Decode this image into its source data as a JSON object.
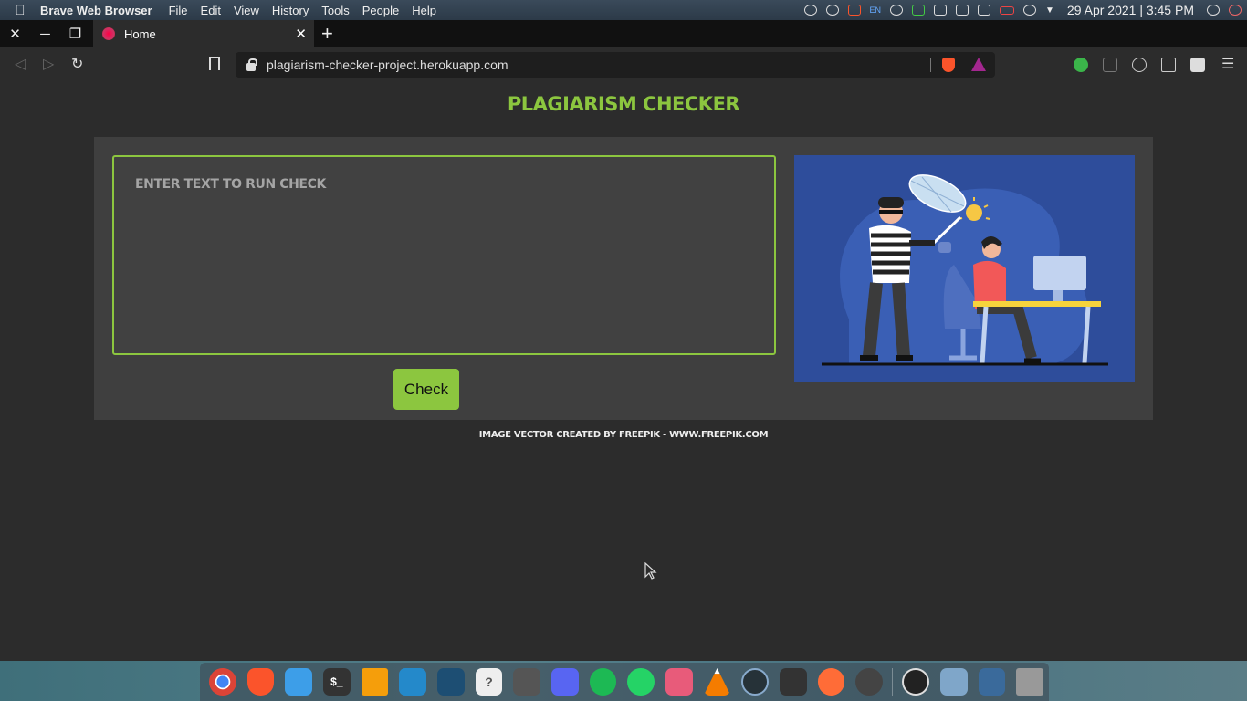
{
  "system_bar": {
    "app_name": "Brave Web Browser",
    "menus": [
      "File",
      "Edit",
      "View",
      "History",
      "Tools",
      "People",
      "Help"
    ],
    "lang": "EN",
    "datetime": "29 Apr 2021 | 3:45 PM"
  },
  "browser": {
    "tab_title": "Home",
    "url": "plagiarism-checker-project.herokuapp.com"
  },
  "page": {
    "title": "PLAGIARISM CHECKER",
    "input_placeholder": "ENTER TEXT TO RUN CHECK",
    "input_value": "",
    "check_label": "Check",
    "credit": "IMAGE VECTOR CREATED BY FREEPIK - WWW.FREEPIK.COM",
    "accent_color": "#8cc63f",
    "illustration": "thief-catching-lightbulb-from-person-at-desk"
  },
  "dock": {
    "icons": [
      "chrome-icon",
      "brave-icon",
      "files-icon",
      "terminal-icon",
      "sublime-icon",
      "vscode-icon",
      "mysql-workbench-icon",
      "unknown-app-icon",
      "calculator-icon",
      "discord-icon",
      "spotify-icon",
      "whatsapp-icon",
      "screenshot-icon",
      "vlc-icon",
      "disk-usage-icon",
      "system-monitor-icon",
      "postman-icon",
      "equalizer-icon",
      "obs-icon",
      "webcam-icon",
      "editor-icon",
      "trash-icon"
    ],
    "terminal_label": "$_",
    "unknown_label": "?"
  }
}
